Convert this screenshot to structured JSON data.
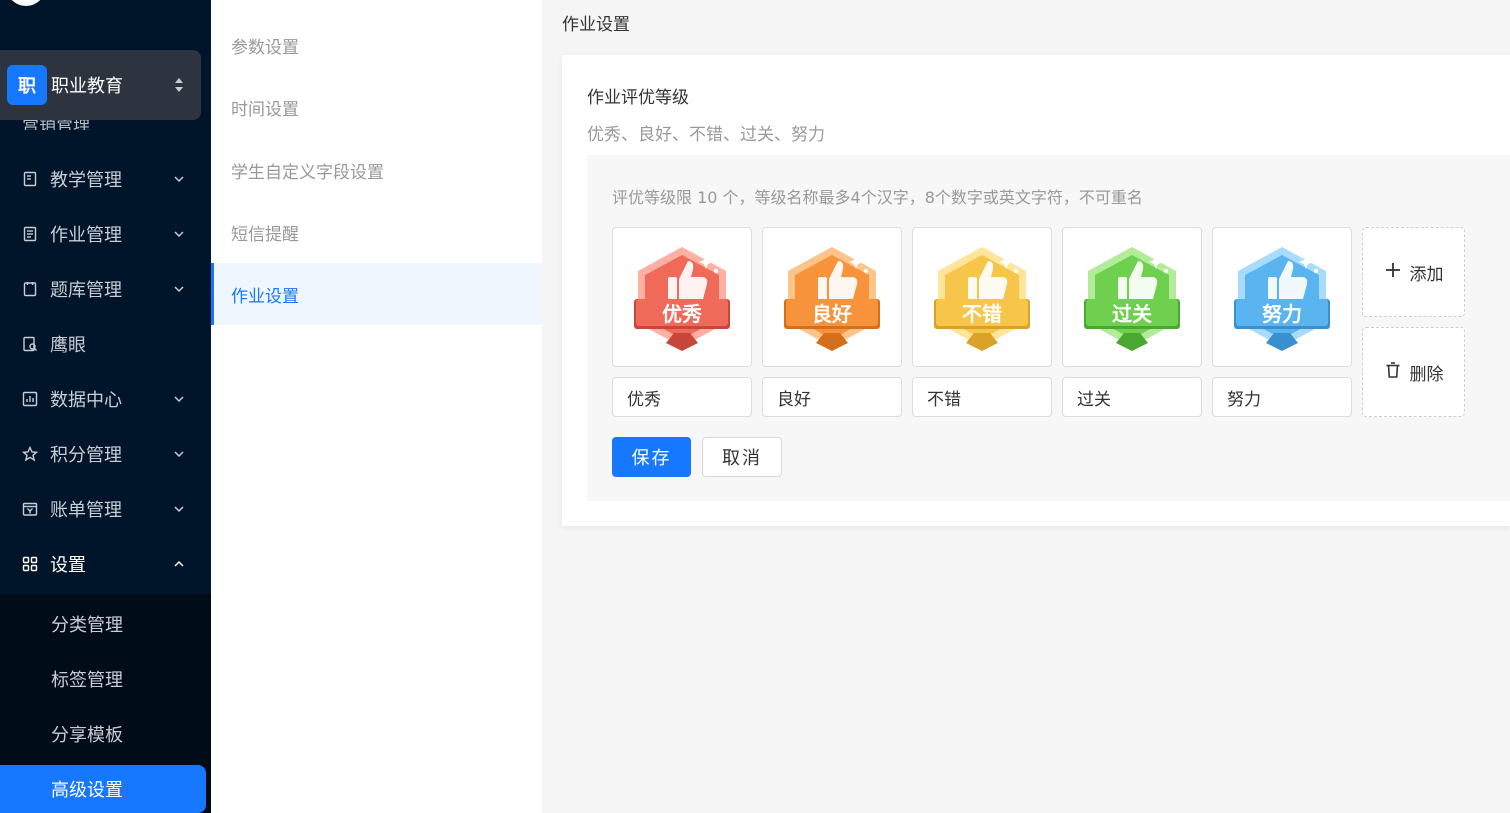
{
  "sidebar": {
    "org_badge": "职",
    "org_name": "职业教育",
    "partial_item_label": "营销管理",
    "items": [
      {
        "label": "教学管理",
        "icon": "book-icon"
      },
      {
        "label": "作业管理",
        "icon": "document-icon"
      },
      {
        "label": "题库管理",
        "icon": "clipboard-icon"
      },
      {
        "label": "鹰眼",
        "icon": "eye-search-icon"
      },
      {
        "label": "数据中心",
        "icon": "bar-chart-icon"
      },
      {
        "label": "积分管理",
        "icon": "star-icon"
      },
      {
        "label": "账单管理",
        "icon": "bill-icon"
      },
      {
        "label": "设置",
        "icon": "grid-icon"
      }
    ],
    "sub_items": [
      {
        "label": "分类管理"
      },
      {
        "label": "标签管理"
      },
      {
        "label": "分享模板"
      },
      {
        "label": "高级设置"
      }
    ]
  },
  "subnav": {
    "items": [
      {
        "label": "参数设置"
      },
      {
        "label": "时间设置"
      },
      {
        "label": "学生自定义字段设置"
      },
      {
        "label": "短信提醒"
      },
      {
        "label": "作业设置"
      }
    ]
  },
  "main": {
    "page_title": "作业设置",
    "section_title": "作业评优等级",
    "section_desc": "优秀、良好、不错、过关、努力",
    "hint": "评优等级限 10 个，等级名称最多4个汉字，8个数字或英文字符，不可重名",
    "grades": [
      {
        "badge_text": "优秀",
        "value": "优秀",
        "color": "#f06a5a",
        "light": "#ffb0a3",
        "dark": "#c9463a"
      },
      {
        "badge_text": "良好",
        "value": "良好",
        "color": "#f7933b",
        "light": "#ffc48a",
        "dark": "#d46f1e"
      },
      {
        "badge_text": "不错",
        "value": "不错",
        "color": "#f7c54a",
        "light": "#ffe49a",
        "dark": "#dba22a"
      },
      {
        "badge_text": "过关",
        "value": "过关",
        "color": "#6fcf4f",
        "light": "#b2ec98",
        "dark": "#4aa832"
      },
      {
        "badge_text": "努力",
        "value": "努力",
        "color": "#5ab4f0",
        "light": "#a8dcff",
        "dark": "#3a90cf"
      }
    ],
    "add_label": "添加",
    "delete_label": "删除",
    "save_label": "保存",
    "cancel_label": "取消"
  }
}
